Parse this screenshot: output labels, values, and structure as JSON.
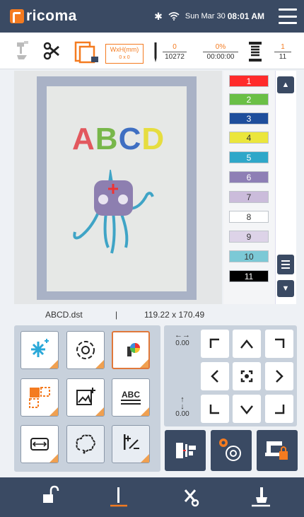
{
  "app": {
    "logo_text": "ricoma"
  },
  "status": {
    "date": "Sun Mar 30",
    "time": "08:01 AM",
    "icons": [
      "bluetooth-icon",
      "wifi-icon"
    ]
  },
  "toolbar": {
    "dims_label": "WxH(mm)",
    "dims_value": "0 x 0",
    "stitch_current": "0",
    "stitch_total": "10272",
    "progress_percent": "0%",
    "progress_time": "00:00:00",
    "color_current": "1",
    "color_total": "11"
  },
  "preview": {
    "design_letters": [
      "A",
      "B",
      "C",
      "D"
    ],
    "letter_colors": [
      "#e2585e",
      "#78b74a",
      "#3f6fc2",
      "#e6dd3f"
    ]
  },
  "colors": [
    {
      "n": "1",
      "hex": "#ff2b2b",
      "text": "#ffffff"
    },
    {
      "n": "2",
      "hex": "#6abf46",
      "text": "#ffffff"
    },
    {
      "n": "3",
      "hex": "#1e4e9c",
      "text": "#ffffff"
    },
    {
      "n": "4",
      "hex": "#ebe63c",
      "text": "#333333"
    },
    {
      "n": "5",
      "hex": "#2fa7c9",
      "text": "#ffffff"
    },
    {
      "n": "6",
      "hex": "#8e7fb5",
      "text": "#ffffff"
    },
    {
      "n": "7",
      "hex": "#cbbcdb",
      "text": "#333333"
    },
    {
      "n": "8",
      "hex": "#ffffff",
      "text": "#333333"
    },
    {
      "n": "9",
      "hex": "#ddd3e8",
      "text": "#333333"
    },
    {
      "n": "10",
      "hex": "#7cc9d6",
      "text": "#333333"
    },
    {
      "n": "11",
      "hex": "#000000",
      "text": "#ffffff"
    }
  ],
  "info": {
    "filename": "ABCD.dst",
    "separator": "|",
    "size": "119.22 x 170.49"
  },
  "move": {
    "x_value": "0.00",
    "y_value": "0.00"
  },
  "accent": "#f47b20",
  "dark": "#3a4a63"
}
